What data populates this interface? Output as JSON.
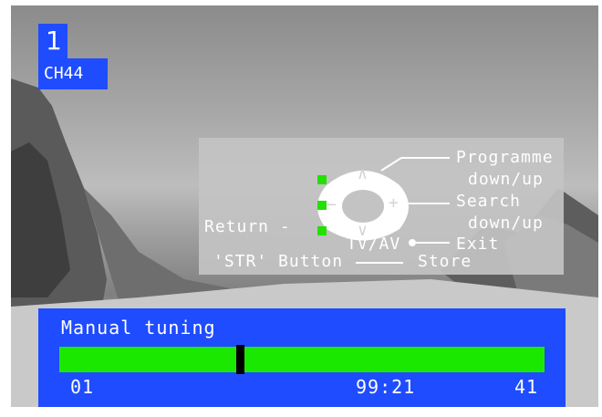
{
  "channel": {
    "number": "1",
    "name": "CH44"
  },
  "guide": {
    "programme_label": "Programme",
    "programme_sub": "down/up",
    "search_label": "Search",
    "search_sub": "down/up",
    "exit_label": "Exit",
    "return_label": "Return -",
    "tvav_label": "TV/AV",
    "str_button_label": "'STR' Button",
    "store_label": "Store",
    "up_icon": "∧",
    "down_icon": "∨",
    "minus_icon": "−",
    "plus_icon": "+"
  },
  "tuning": {
    "title": "Manual tuning",
    "start_label": "01",
    "frequency": "99:21",
    "end_label": "41",
    "progress_fraction": 0.37
  },
  "colors": {
    "panel_blue": "#1f4cff",
    "bar_green": "#1be800",
    "led_green": "#22e000"
  }
}
